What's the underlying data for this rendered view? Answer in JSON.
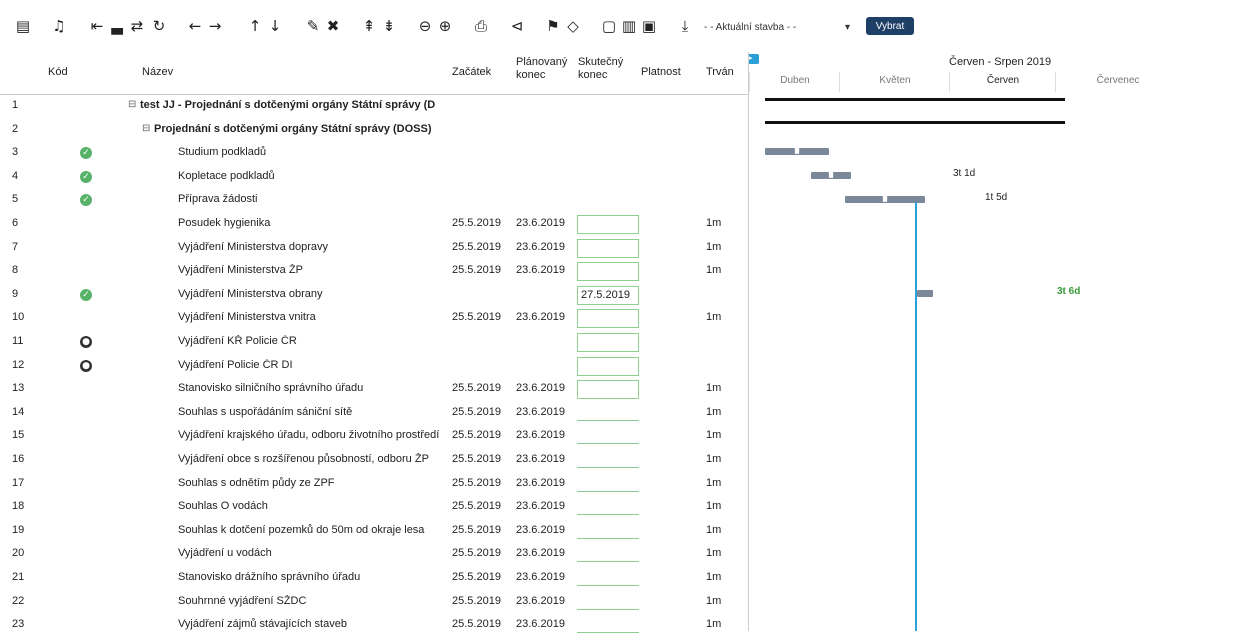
{
  "toolbar": {
    "version_select_value": "- - Aktuální stavba - -",
    "select_button_label": "Vybrat",
    "icons": [
      "list-icon",
      "bell-icon",
      "indent-icon",
      "outdent-icon",
      "link-icon",
      "refresh-icon",
      "left-arrow-icon",
      "right-arrow-icon",
      "up-arrow-icon",
      "down-arrow-icon",
      "edit-icon",
      "delete-icon",
      "expand-icon",
      "collapse-icon",
      "zoom-out-icon",
      "zoom-in-icon",
      "print-icon",
      "share-icon",
      "flag-icon",
      "eraser-icon",
      "view1-icon",
      "view2-icon",
      "view3-icon",
      "download-icon"
    ]
  },
  "grid": {
    "headers": {
      "kod": "Kód",
      "nazev": "Název",
      "zacatek": "Začátek",
      "planovany_konec": "Plánovaný konec",
      "skutecny_konec": "Skutečný konec",
      "platnost": "Platnost",
      "trvani": "Trván"
    },
    "rows": [
      {
        "num": "1",
        "name": "test JJ - Projednání s dotčenými orgány Státní správy (D",
        "start": "",
        "plan": "",
        "actual": "",
        "dur": "",
        "status": "",
        "level": 0,
        "bold": true
      },
      {
        "num": "2",
        "name": "Projednání s dotčenými orgány Státní správy (DOSS)",
        "start": "",
        "plan": "",
        "actual": "",
        "dur": "",
        "status": "",
        "level": 1,
        "bold": true
      },
      {
        "num": "3",
        "name": "Studium podkladů",
        "start": "",
        "plan": "",
        "actual": "",
        "dur": "",
        "status": "done",
        "level": 2,
        "bold": false
      },
      {
        "num": "4",
        "name": "Kopletace podkladů",
        "start": "",
        "plan": "",
        "actual": "",
        "dur": "",
        "status": "done",
        "level": 2,
        "bold": false
      },
      {
        "num": "5",
        "name": "Příprava žádosti",
        "start": "",
        "plan": "",
        "actual": "",
        "dur": "",
        "status": "done",
        "level": 2,
        "bold": false
      },
      {
        "num": "6",
        "name": "Posudek hygienika",
        "start": "25.5.2019",
        "plan": "23.6.2019",
        "actual": "",
        "dur": "1m",
        "status": "",
        "level": 2,
        "bold": false
      },
      {
        "num": "7",
        "name": "Vyjádření Ministerstva dopravy",
        "start": "25.5.2019",
        "plan": "23.6.2019",
        "actual": "",
        "dur": "1m",
        "status": "",
        "level": 2,
        "bold": false
      },
      {
        "num": "8",
        "name": "Vyjádření Ministerstva ŽP",
        "start": "25.5.2019",
        "plan": "23.6.2019",
        "actual": "",
        "dur": "1m",
        "status": "",
        "level": 2,
        "bold": false
      },
      {
        "num": "9",
        "name": "Vyjádření Ministerstva obrany",
        "start": "",
        "plan": "",
        "actual": "27.5.2019",
        "dur": "",
        "status": "done",
        "level": 2,
        "bold": false
      },
      {
        "num": "10",
        "name": "Vyjádření Ministerstva vnitra",
        "start": "25.5.2019",
        "plan": "23.6.2019",
        "actual": "",
        "dur": "1m",
        "status": "",
        "level": 2,
        "bold": false
      },
      {
        "num": "11",
        "name": "Vyjádření KŘ Policie ČR",
        "start": "",
        "plan": "",
        "actual": "",
        "dur": "",
        "status": "blocked",
        "level": 2,
        "bold": false
      },
      {
        "num": "12",
        "name": "Vyjádření Policie ČR DI",
        "start": "",
        "plan": "",
        "actual": "",
        "dur": "",
        "status": "blocked",
        "level": 2,
        "bold": false
      },
      {
        "num": "13",
        "name": "Stanovisko silničního správního úřadu",
        "start": "25.5.2019",
        "plan": "23.6.2019",
        "actual": "",
        "dur": "1m",
        "status": "",
        "level": 2,
        "bold": false
      },
      {
        "num": "14",
        "name": "Souhlas s uspořádáním sániční sítě",
        "start": "25.5.2019",
        "plan": "23.6.2019",
        "actual": "",
        "dur": "1m",
        "status": "",
        "level": 2,
        "bold": false
      },
      {
        "num": "15",
        "name": "Vyjádření krajského úřadu, odboru životního prostředí",
        "start": "25.5.2019",
        "plan": "23.6.2019",
        "actual": "",
        "dur": "1m",
        "status": "",
        "level": 2,
        "bold": false
      },
      {
        "num": "16",
        "name": "Vyjádření obce s rozšířenou působností, odboru ŽP",
        "start": "25.5.2019",
        "plan": "23.6.2019",
        "actual": "",
        "dur": "1m",
        "status": "",
        "level": 2,
        "bold": false
      },
      {
        "num": "17",
        "name": "Souhlas s odnětím půdy ze ZPF",
        "start": "25.5.2019",
        "plan": "23.6.2019",
        "actual": "",
        "dur": "1m",
        "status": "",
        "level": 2,
        "bold": false
      },
      {
        "num": "18",
        "name": "Souhlas O vodách",
        "start": "25.5.2019",
        "plan": "23.6.2019",
        "actual": "",
        "dur": "1m",
        "status": "",
        "level": 2,
        "bold": false
      },
      {
        "num": "19",
        "name": "Souhlas k dotčení pozemků do 50m od okraje lesa",
        "start": "25.5.2019",
        "plan": "23.6.2019",
        "actual": "",
        "dur": "1m",
        "status": "",
        "level": 2,
        "bold": false
      },
      {
        "num": "20",
        "name": "Vyjádření u vodách",
        "start": "25.5.2019",
        "plan": "23.6.2019",
        "actual": "",
        "dur": "1m",
        "status": "",
        "level": 2,
        "bold": false
      },
      {
        "num": "21",
        "name": "Stanovisko drážního správního úřadu",
        "start": "25.5.2019",
        "plan": "23.6.2019",
        "actual": "",
        "dur": "1m",
        "status": "",
        "level": 2,
        "bold": false
      },
      {
        "num": "22",
        "name": "Souhrnné vyjádření SŽDC",
        "start": "25.5.2019",
        "plan": "23.6.2019",
        "actual": "",
        "dur": "1m",
        "status": "",
        "level": 2,
        "bold": false
      },
      {
        "num": "23",
        "name": "Vyjádření zájmů stávajících staveb",
        "start": "25.5.2019",
        "plan": "23.6.2019",
        "actual": "",
        "dur": "1m",
        "status": "",
        "level": 2,
        "bold": false
      }
    ]
  },
  "gantt": {
    "period_label": "Červen - Srpen 2019",
    "months": [
      "Duben",
      "Květen",
      "Červen",
      "Červenec"
    ],
    "labels": {
      "row4": "3t 1d",
      "row5": "1t 5d",
      "row9": "3t 6d"
    }
  }
}
